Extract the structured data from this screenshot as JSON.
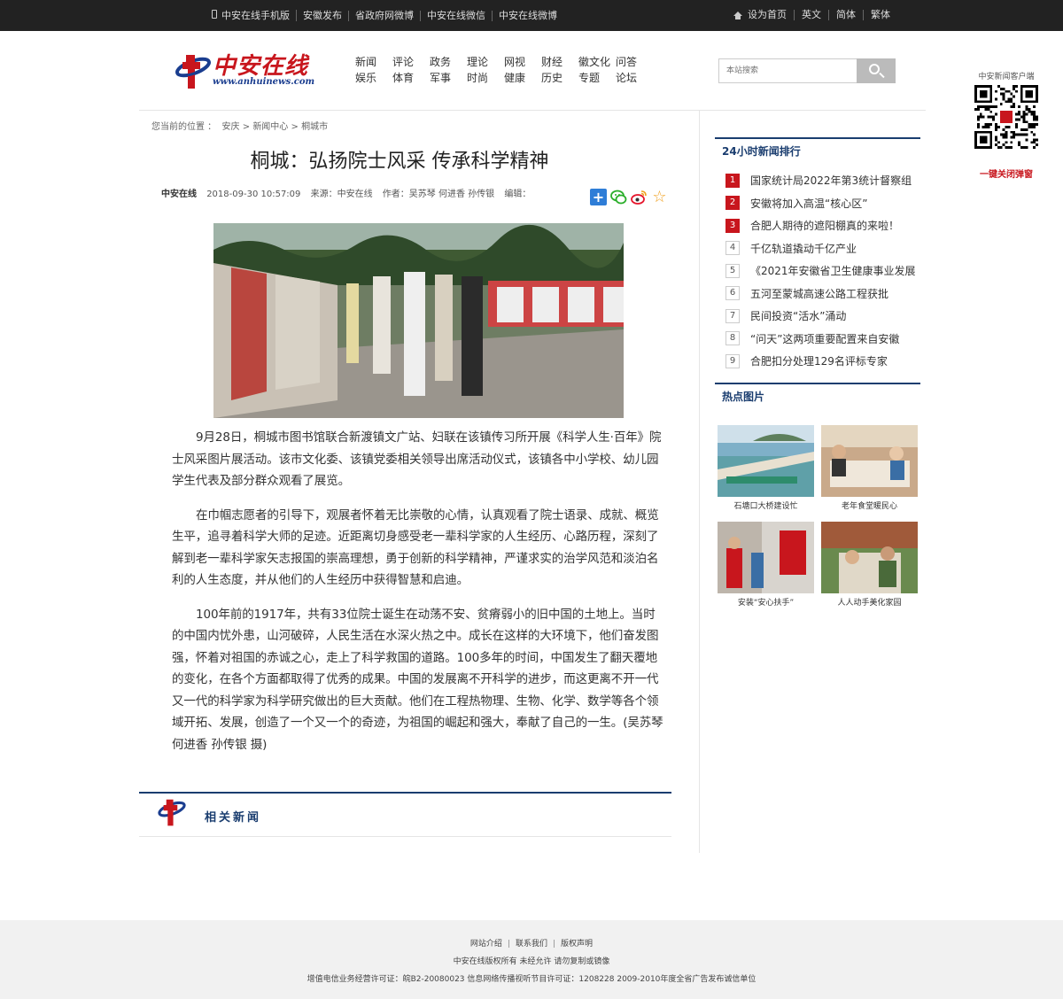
{
  "topbar": {
    "left_items": [
      "中安在线手机版",
      "安徽发布",
      "省政府网微博",
      "中安在线微信",
      "中安在线微博"
    ],
    "right_items": [
      "设为首页",
      "英文",
      "简体",
      "繁体"
    ]
  },
  "header": {
    "logo_text": "中安在线",
    "logo_url": "www.anhuinews.com",
    "nav": [
      "新闻",
      "评论",
      "政务",
      "理论",
      "网视",
      "财经",
      "徽文化",
      "问答",
      "娱乐",
      "体育",
      "军事",
      "时尚",
      "健康",
      "历史",
      "专题",
      "论坛"
    ],
    "search_placeholder": "本站搜索"
  },
  "qr": {
    "title": "中安新闻客户端",
    "close": "一键关闭弹窗"
  },
  "breadcrumb": {
    "prefix": "您当前的位置 ：",
    "items": [
      "安庆",
      "新闻中心",
      "桐城市"
    ],
    "sep": ">"
  },
  "article": {
    "title": "桐城：弘扬院士风采 传承科学精神",
    "source_site": "中安在线",
    "datetime": "2018-09-30 10:57:09",
    "source": "来源：中安在线",
    "author": "作者：吴苏琴 何进香 孙传银",
    "editor": "编辑：",
    "paragraphs": [
      "9月28日，桐城市图书馆联合新渡镇文广站、妇联在该镇传习所开展《科学人生·百年》院士风采图片展活动。该市文化委、该镇党委相关领导出席活动仪式，该镇各中小学校、幼儿园学生代表及部分群众观看了展览。",
      "在巾帼志愿者的引导下，观展者怀着无比崇敬的心情，认真观看了院士语录、成就、概览生平，追寻着科学大师的足迹。近距离切身感受老一辈科学家的人生经历、心路历程，深刻了解到老一辈科学家矢志报国的崇高理想，勇于创新的科学精神，严谨求实的治学风范和淡泊名利的人生态度，并从他们的人生经历中获得智慧和启迪。",
      "100年前的1917年，共有33位院士诞生在动荡不安、贫瘠弱小的旧中国的土地上。当时的中国内忧外患，山河破碎，人民生活在水深火热之中。成长在这样的大环境下，他们奋发图强，怀着对祖国的赤诚之心，走上了科学救国的道路。100多年的时间，中国发生了翻天覆地的变化，在各个方面都取得了优秀的成果。中国的发展离不开科学的进步，而这更离不开一代又一代的科学家为科学研究做出的巨大贡献。他们在工程热物理、生物、化学、数学等各个领域开拓、发展，创造了一个又一个的奇迹，为祖国的崛起和强大，奉献了自己的一生。(吴苏琴 何进香 孙传银 摄)"
    ]
  },
  "related": {
    "title": "相关新闻"
  },
  "sidebar": {
    "rank_title": "24小时新闻排行",
    "rank": [
      {
        "num": "1",
        "text": "国家统计局2022年第3统计督察组"
      },
      {
        "num": "2",
        "text": "安徽将加入高温“核心区”"
      },
      {
        "num": "3",
        "text": "合肥人期待的遮阳棚真的来啦！"
      },
      {
        "num": "4",
        "text": "千亿轨道撬动千亿产业"
      },
      {
        "num": "5",
        "text": "《2021年安徽省卫生健康事业发展"
      },
      {
        "num": "6",
        "text": "五河至蒙城高速公路工程获批"
      },
      {
        "num": "7",
        "text": "民间投资“活水”涌动"
      },
      {
        "num": "8",
        "text": "“问天”这两项重要配置来自安徽"
      },
      {
        "num": "9",
        "text": "合肥扣分处理129名评标专家"
      }
    ],
    "pics_title": "热点图片",
    "pics": [
      {
        "caption": "石塘口大桥建设忙"
      },
      {
        "caption": "老年食堂暖民心"
      },
      {
        "caption": "安装“安心扶手”"
      },
      {
        "caption": "人人动手美化家园"
      }
    ]
  },
  "footer": {
    "links": [
      "网站介绍",
      "联系我们",
      "版权声明"
    ],
    "copyright": "中安在线版权所有 未经允许 请勿复制或镜像",
    "license": "增值电信业务经营许可证：皖B2-20080023 信息网络传播视听节目许可证：1208228  2009-2010年度全省广告发布诚信单位"
  },
  "colors": {
    "brand_red": "#c8161d",
    "brand_blue": "#1a3d6f",
    "topbar_bg": "#222222",
    "footer_bg": "#f1f1f1"
  }
}
